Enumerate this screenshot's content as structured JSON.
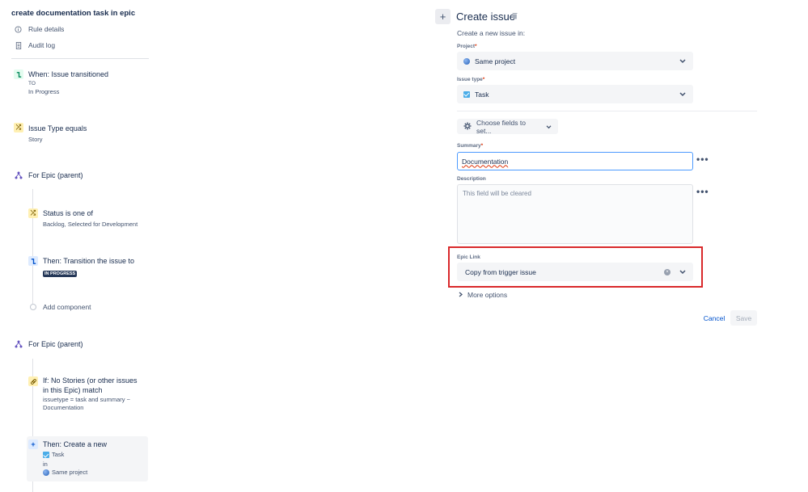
{
  "rule": {
    "title": "create documentation task in epic",
    "nav": [
      {
        "label": "Rule details",
        "icon": "info-icon"
      },
      {
        "label": "Audit log",
        "icon": "document-icon"
      }
    ]
  },
  "flow": {
    "trigger": {
      "title": "When: Issue transitioned",
      "line1": "TO",
      "line2": "In Progress"
    },
    "condition1": {
      "title": "Issue Type equals",
      "sub": "Story"
    },
    "branch1": {
      "title": "For Epic (parent)"
    },
    "status_cond": {
      "title": "Status is one of",
      "sub": "Backlog, Selected for Development"
    },
    "transition": {
      "title": "Then: Transition the issue to",
      "lozenge": "IN PROGRESS"
    },
    "add_component": {
      "label": "Add component"
    },
    "branch2": {
      "title": "For Epic (parent)"
    },
    "if_cond": {
      "title_line1": "If: No Stories (or other issues",
      "title_line2": "in this Epic) match",
      "sub_line1": "issuetype = task and summary ~",
      "sub_line2": "Documentation"
    },
    "create_action": {
      "title": "Then: Create a new",
      "issue_type": "Task",
      "in": "in",
      "project": "Same project"
    }
  },
  "panel": {
    "title": "Create issue",
    "subtitle": "Create a new issue in:",
    "project_label": "Project",
    "project_value": "Same project",
    "issue_type_label": "Issue type",
    "issue_type_value": "Task",
    "required_mark": "*",
    "choose_fields": "Choose fields to set...",
    "summary_label": "Summary",
    "summary_value": "Documentation",
    "description_label": "Description",
    "description_placeholder": "This field will be cleared",
    "epic_label": "Epic Link",
    "epic_value": "Copy from trigger issue",
    "more_options": "More options",
    "cancel": "Cancel",
    "save": "Save",
    "more_actions": "•••"
  },
  "colors": {
    "accent": "#0052cc",
    "highlight": "#d9292b",
    "focus": "#4c9aff"
  }
}
